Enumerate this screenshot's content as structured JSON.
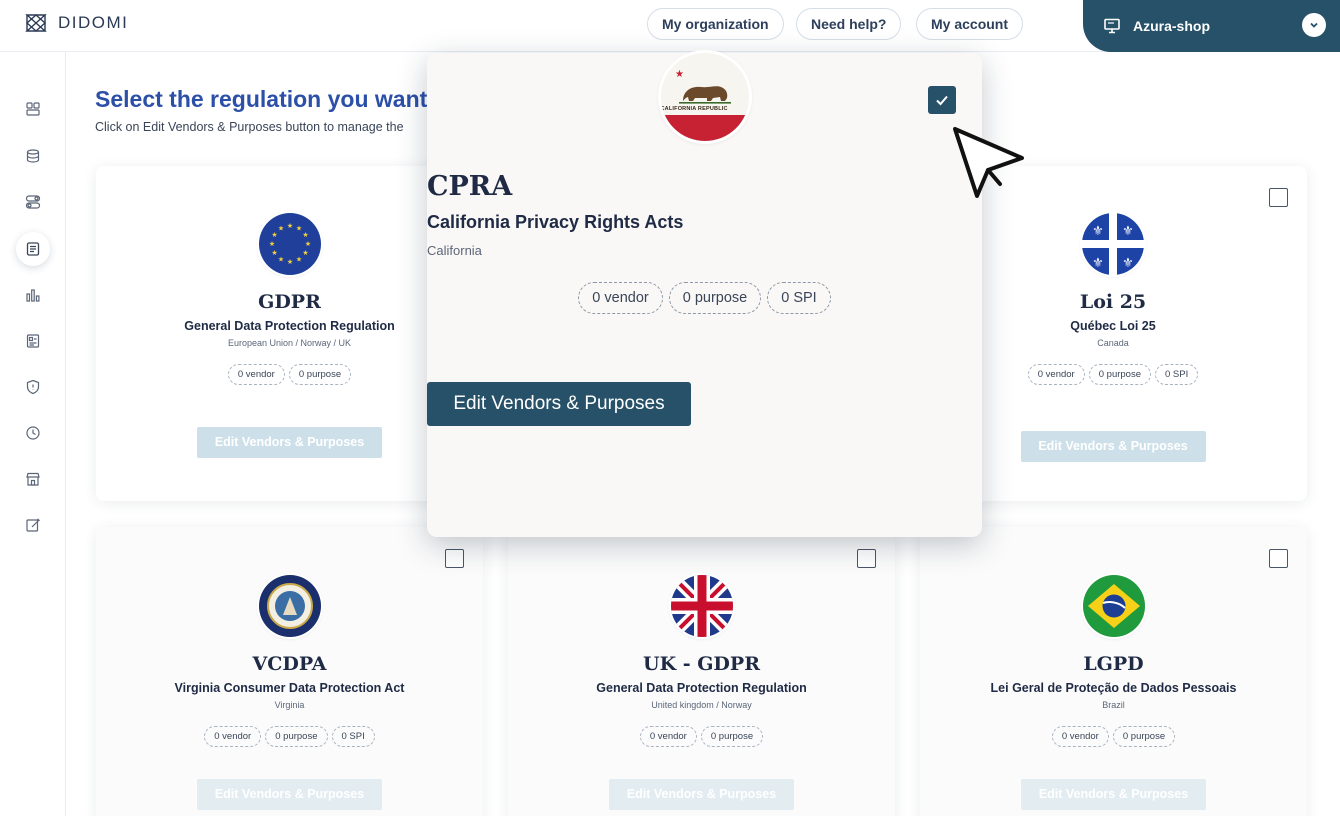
{
  "header": {
    "brand": "DIDOMI",
    "nav": [
      "My organization",
      "Need help?",
      "My account"
    ],
    "org_name": "Azura-shop"
  },
  "page": {
    "title": "Select the regulation you want",
    "subtitle": "Click on Edit Vendors & Purposes button to manage the"
  },
  "regulations": [
    {
      "code": "GDPR",
      "name": "General Data Protection Regulation",
      "region": "European Union / Norway / UK",
      "tags": [
        "0 vendor",
        "0 purpose"
      ],
      "button": "Edit Vendors & Purposes"
    },
    {
      "code": "Loi 25",
      "name": "Québec Loi 25",
      "region": "Canada",
      "tags": [
        "0 vendor",
        "0 purpose",
        "0 SPI"
      ],
      "button": "Edit Vendors & Purposes"
    },
    {
      "code": "VCDPA",
      "name": "Virginia Consumer Data Protection Act",
      "region": "Virginia",
      "tags": [
        "0 vendor",
        "0 purpose",
        "0 SPI"
      ],
      "button": "Edit Vendors & Purposes"
    },
    {
      "code": "UK - GDPR",
      "name": "General Data Protection Regulation",
      "region": "United kingdom / Norway",
      "tags": [
        "0 vendor",
        "0 purpose"
      ],
      "button": "Edit Vendors & Purposes"
    },
    {
      "code": "LGPD",
      "name": "Lei Geral de Proteção de Dados Pessoais",
      "region": "Brazil",
      "tags": [
        "0 vendor",
        "0 purpose"
      ],
      "button": "Edit Vendors & Purposes"
    }
  ],
  "selected": {
    "code": "CPRA",
    "name": "California Privacy Rights Acts",
    "region": "California",
    "tags": [
      "0 vendor",
      "0 purpose",
      "0 SPI"
    ],
    "button": "Edit Vendors & Purposes",
    "flag_text": "CALIFORNIA REPUBLIC",
    "checked": true
  },
  "icons": {
    "logo": "didomi-logo-icon",
    "org": "monitor-icon",
    "cursor": "mouse-pointer-icon"
  },
  "colors": {
    "primary": "#275169",
    "title": "#2c4fa8",
    "disabled_button": "#cde0ea"
  }
}
